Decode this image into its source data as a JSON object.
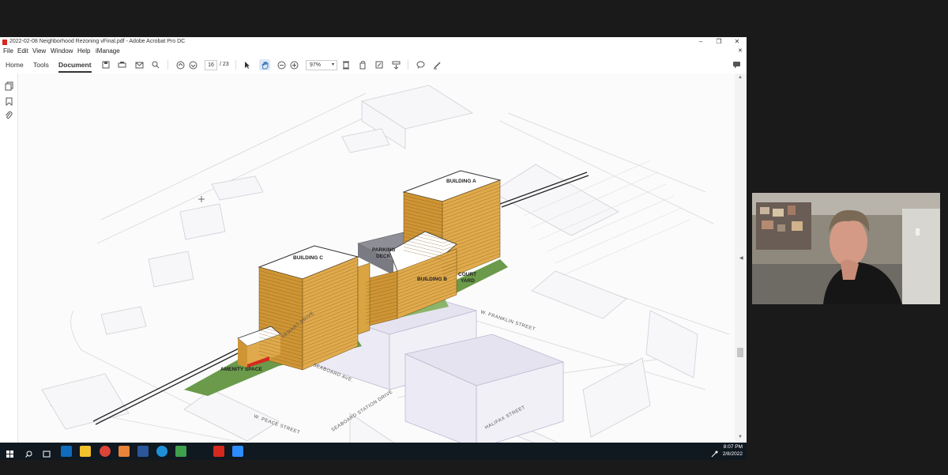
{
  "window": {
    "title": "2022-02-08 Neighborhood Rezoning vFinal.pdf - Adobe Acrobat Pro DC",
    "minimize": "–",
    "maximize": "❐",
    "close": "✕",
    "sub_close": "✕"
  },
  "menu": [
    "File",
    "Edit",
    "View",
    "Window",
    "Help",
    "iManage"
  ],
  "tabs": [
    "Home",
    "Tools",
    "Document"
  ],
  "page": {
    "current": "16",
    "total": "/ 23"
  },
  "zoom": "97%",
  "drawing_labels": {
    "building_a": "BUILDING A",
    "building_b": "BUILDING B",
    "building_c": "BUILDING C",
    "parking_line1": "PARKING",
    "parking_line2": "DECK",
    "court_line1": "COURT",
    "court_line2": "YARD",
    "amenity": "AMENITY SPACE"
  },
  "streets": {
    "w_franklin": "W. FRANKLIN STREET",
    "seaboard_ave": "SEABOARD AVE.",
    "seaboard_station": "SEABOARD STATION DRIVE",
    "halifax": "HALIFAX STREET",
    "w_peace": "W. PEACE STREET",
    "semart": "SEMART DRIVE"
  },
  "taskbar": {
    "time": "8:07 PM",
    "date": "2/8/2022"
  },
  "colors": {
    "building": "#d9a441",
    "green": "#6a9a4a",
    "accent_red": "#d6281e"
  }
}
